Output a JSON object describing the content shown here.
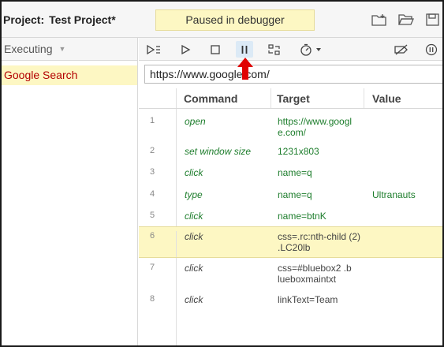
{
  "header": {
    "project_label": "Project:",
    "project_name": "Test Project*",
    "status": "Paused in debugger",
    "icons": [
      "new-folder-icon",
      "open-folder-icon",
      "save-icon"
    ]
  },
  "left_panel": {
    "dropdown_label": "Executing",
    "suites": [
      {
        "label": "Google Search"
      }
    ]
  },
  "toolbar": {
    "icons": [
      "run-all-icon",
      "run-icon",
      "stop-icon",
      "pause-icon",
      "step-over-icon",
      "speed-icon",
      "disable-breakpoints-icon",
      "pause-on-exceptions-icon"
    ]
  },
  "url": "https://www.google.com/",
  "table": {
    "headers": [
      "Command",
      "Target",
      "Value"
    ],
    "rows": [
      {
        "num": "1",
        "command": "open",
        "target": "https://www.googl e.com/",
        "value": ""
      },
      {
        "num": "2",
        "command": "set window size",
        "target": "1231x803",
        "value": ""
      },
      {
        "num": "3",
        "command": "click",
        "target": "name=q",
        "value": ""
      },
      {
        "num": "4",
        "command": "type",
        "target": "name=q",
        "value": "Ultranauts"
      },
      {
        "num": "5",
        "command": "click",
        "target": "name=btnK",
        "value": ""
      },
      {
        "num": "6",
        "command": "click",
        "target": "css=.rc:nth-child (2) .LC20lb",
        "value": ""
      },
      {
        "num": "7",
        "command": "click",
        "target": "css=#bluebox2 .b lueboxmaintxt",
        "value": ""
      },
      {
        "num": "8",
        "command": "click",
        "target": "linkText=Team",
        "value": ""
      }
    ]
  },
  "colors": {
    "highlight": "#fdf7c3",
    "command_text": "#1d7d2c",
    "suite_text": "#b30000",
    "annotation_arrow": "#e00000"
  }
}
